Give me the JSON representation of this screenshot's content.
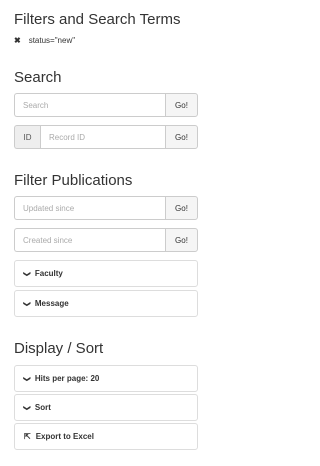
{
  "filters": {
    "heading": "Filters and Search Terms",
    "active": [
      {
        "label": "status=\"new\"",
        "icon": "remove-icon"
      }
    ]
  },
  "search": {
    "heading": "Search",
    "query_placeholder": "Search",
    "id_addon": "ID",
    "id_placeholder": "Record ID",
    "go_label": "Go!"
  },
  "filter_publications": {
    "heading": "Filter Publications",
    "updated_placeholder": "Updated since",
    "created_placeholder": "Created since",
    "go_label": "Go!",
    "panels": [
      {
        "label": "Faculty",
        "icon": "chevron-down-icon"
      },
      {
        "label": "Message",
        "icon": "chevron-down-icon"
      }
    ]
  },
  "display_sort": {
    "heading": "Display / Sort",
    "panels": [
      {
        "label": "Hits per page: 20",
        "icon": "chevron-down-icon"
      },
      {
        "label": "Sort",
        "icon": "chevron-down-icon"
      },
      {
        "label": "Export to Excel",
        "icon": "external-link-icon"
      }
    ]
  }
}
